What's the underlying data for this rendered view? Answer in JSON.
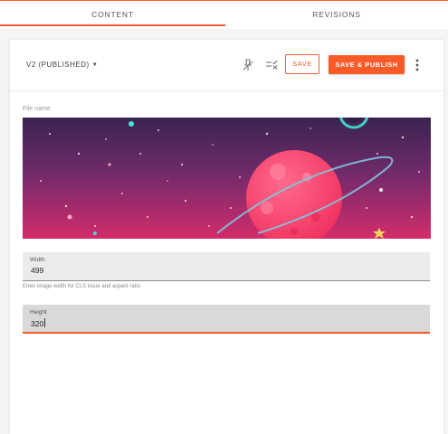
{
  "tabs": [
    {
      "label": "CONTENT",
      "active": true
    },
    {
      "label": "REVISIONS",
      "active": false
    }
  ],
  "header": {
    "revision_label": "V2 (PUBLISHED)",
    "save_label": "SAVE",
    "publish_label": "SAVE & PUBLISH"
  },
  "icons": {
    "pin": "pin-icon",
    "checklist": "checklist-icon",
    "more": "more-vertical-icon",
    "caret": "caret-down-icon"
  },
  "form": {
    "file_label": "File name",
    "width_label": "Width",
    "width_value": "499",
    "width_helper": "Enter image width for CLS issue and aspect ratio",
    "height_label": "Height",
    "height_value": "320"
  },
  "colors": {
    "accent": "#fa5a28",
    "banner_top": "#3a2450",
    "banner_bottom": "#d42c6a",
    "planet": "#ff3f6e",
    "ring": "#6fb7d8"
  }
}
